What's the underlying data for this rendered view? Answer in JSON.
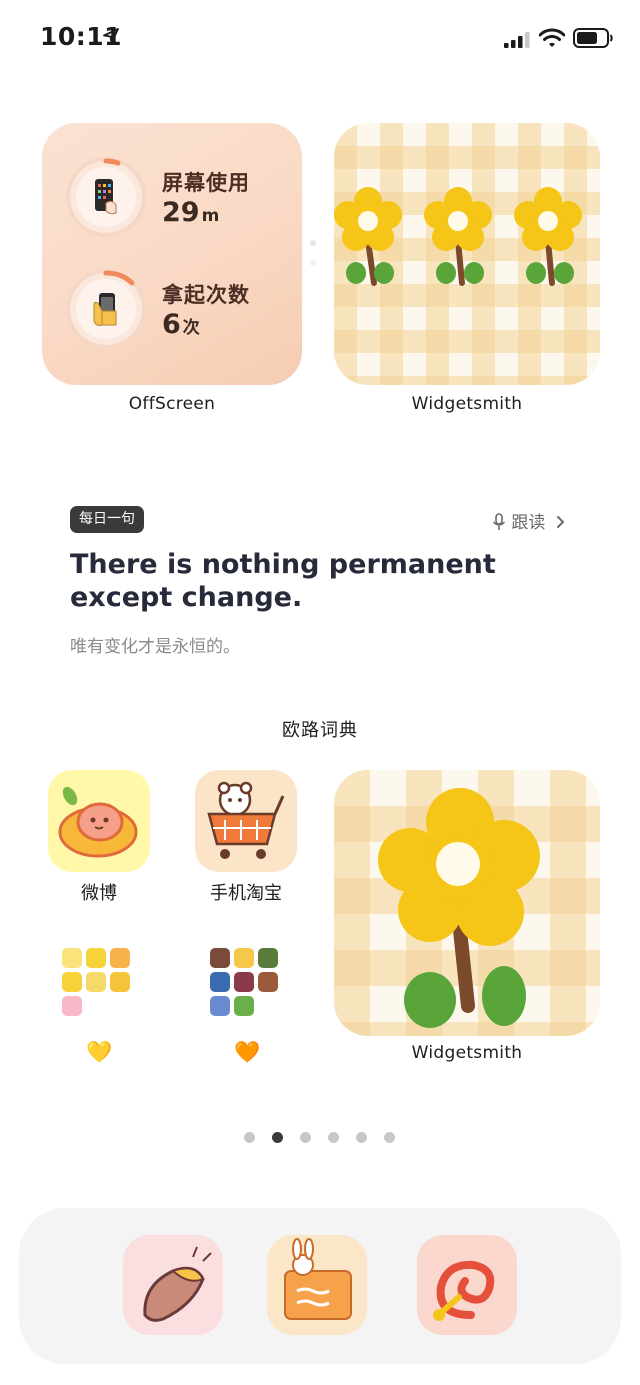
{
  "status_bar": {
    "time": "10:11"
  },
  "offscreen": {
    "screen_use_label": "屏幕使用",
    "screen_use_value": "29",
    "screen_use_unit": "m",
    "pickups_label": "拿起次数",
    "pickups_value": "6",
    "pickups_unit": "次",
    "caption": "OffScreen"
  },
  "widgetsmith_small": {
    "caption": "Widgetsmith"
  },
  "daily_quote": {
    "tag": "每日一句",
    "follow_label": "跟读",
    "quote": "There is nothing permanent except change.",
    "translation": "唯有变化才是永恒的。",
    "source": "欧路词典"
  },
  "apps": [
    {
      "label": "微博"
    },
    {
      "label": "手机淘宝"
    }
  ],
  "folders": [
    {
      "label": "💛"
    },
    {
      "label": "🧡"
    }
  ],
  "widgetsmith_large": {
    "caption": "Widgetsmith"
  },
  "page_dots": {
    "count": 6,
    "active": 2
  },
  "colors": {
    "offscreen_bg": "#f9d9c5",
    "gingham": "#f3d396",
    "flower": "#f5c518",
    "tag_bg": "#3a3a3a"
  }
}
